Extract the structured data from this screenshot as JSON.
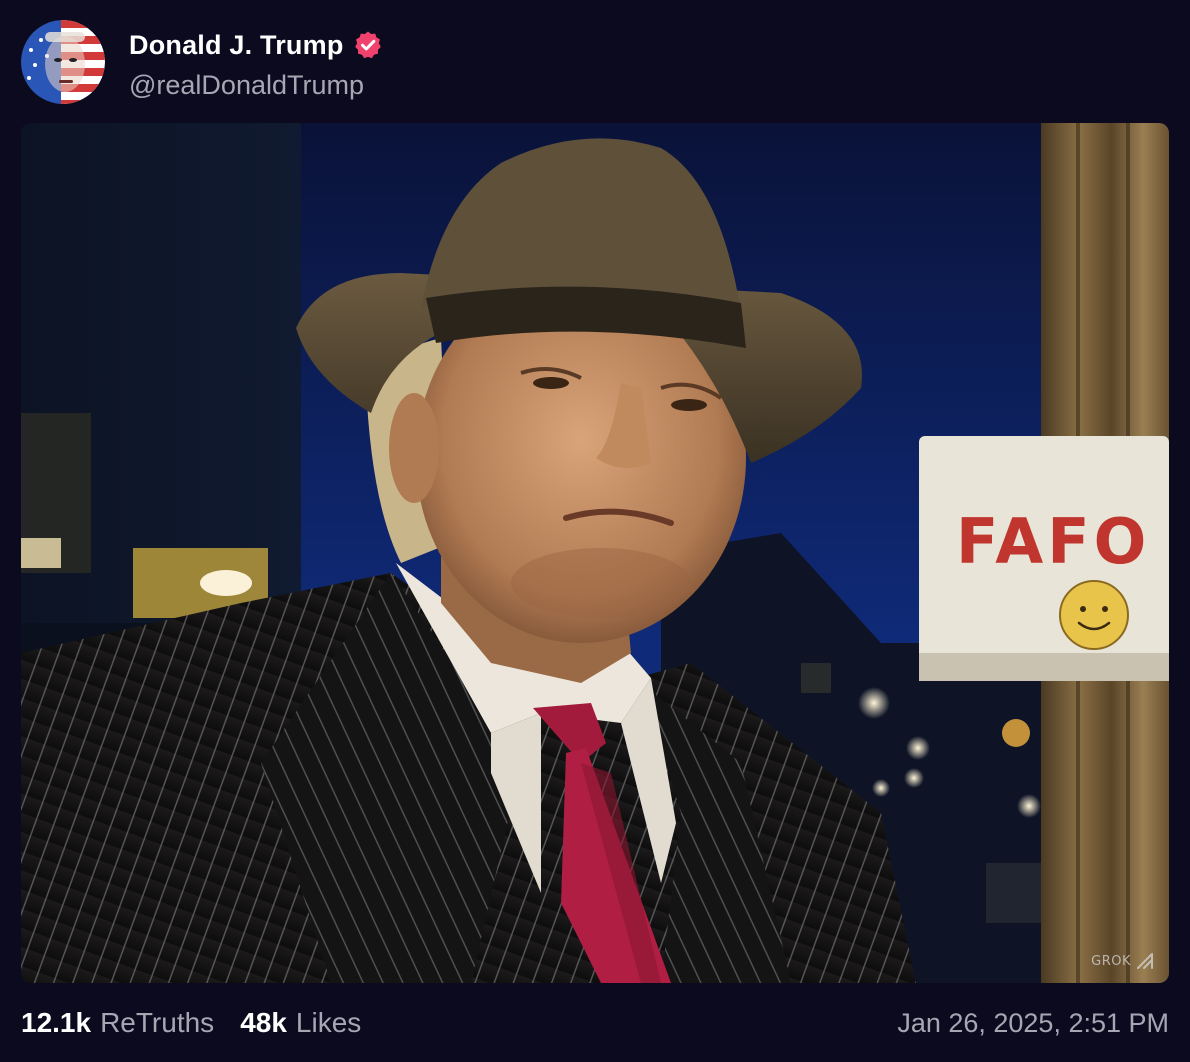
{
  "author": {
    "display_name": "Donald J. Trump",
    "handle": "@realDonaldTrump",
    "verified": true,
    "avatar_icon": "flag-face-avatar"
  },
  "media": {
    "sign_text": "FAFO",
    "watermark": "GROK"
  },
  "stats": {
    "retruths_count": "12.1k",
    "retruths_label": "ReTruths",
    "likes_count": "48k",
    "likes_label": "Likes"
  },
  "timestamp": "Jan 26, 2025, 2:51 PM",
  "colors": {
    "background": "#0b0a1e",
    "text_primary": "#ffffff",
    "text_secondary": "#a8a6b3",
    "verified_badge": "#f0426d"
  }
}
